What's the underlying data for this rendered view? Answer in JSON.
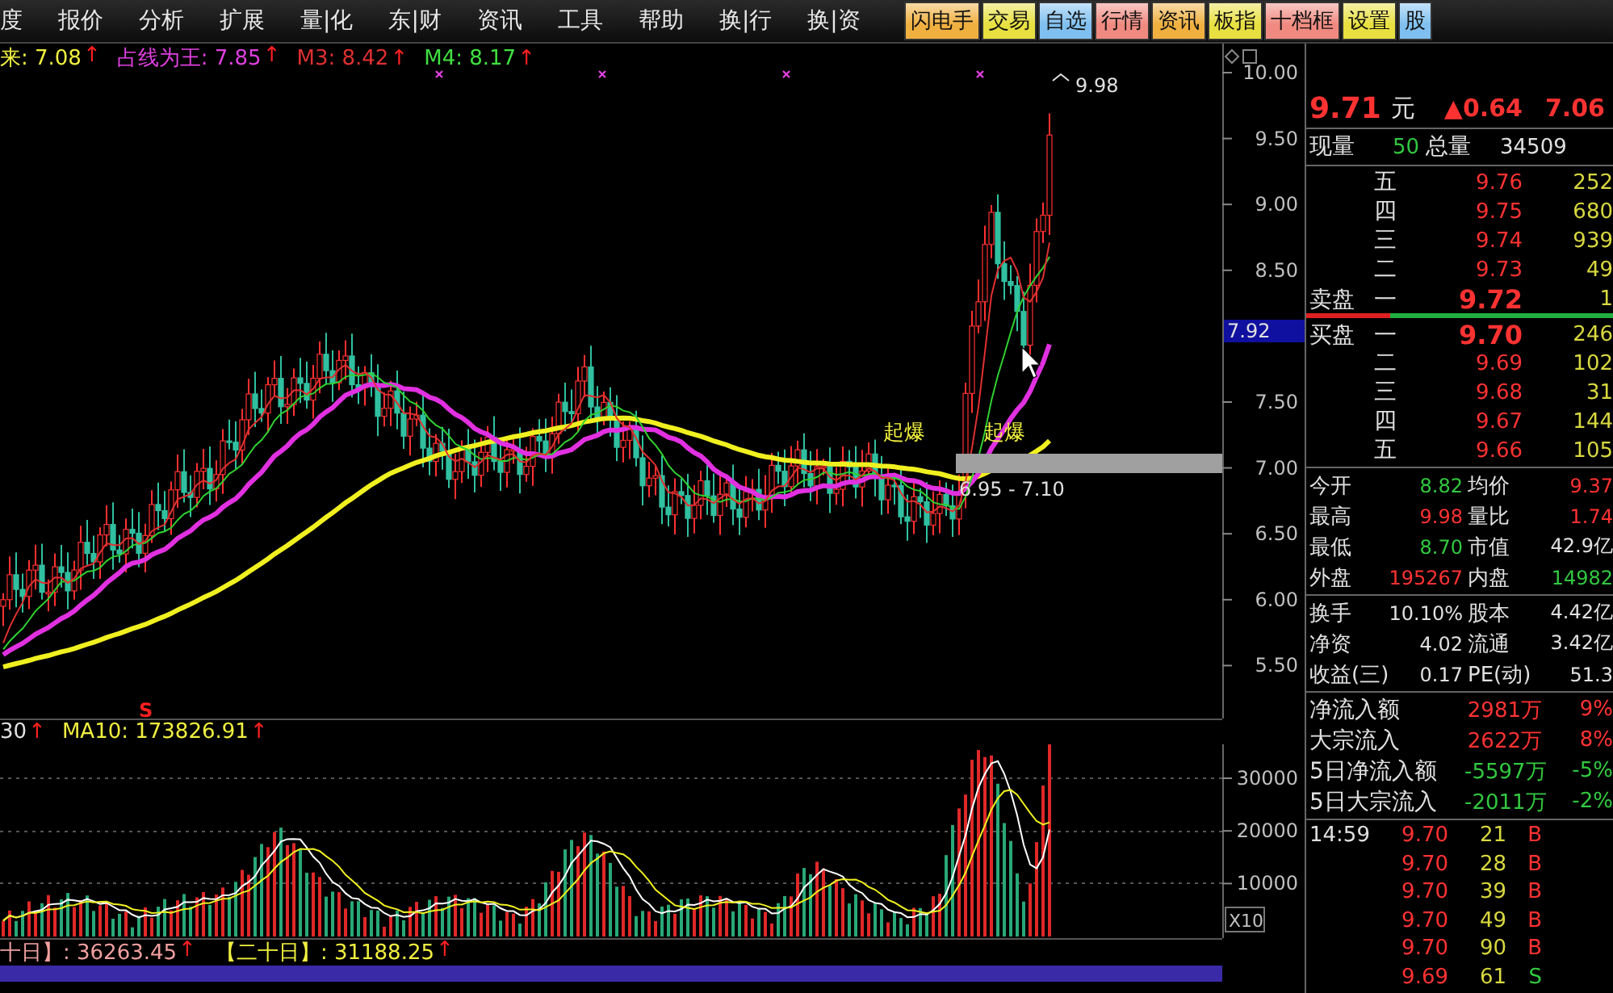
{
  "menu": [
    {
      "label": "度"
    },
    {
      "label": "报价"
    },
    {
      "label": "分析"
    },
    {
      "label": "扩展"
    },
    {
      "label": "量|化"
    },
    {
      "label": "东|财"
    },
    {
      "label": "资讯"
    },
    {
      "label": "工具"
    },
    {
      "label": "帮助"
    },
    {
      "label": "换|行"
    },
    {
      "label": "换|资"
    }
  ],
  "quick_buttons": [
    {
      "label": "闪电手",
      "color": "#f0b040"
    },
    {
      "label": "交易",
      "color": "#e8e040"
    },
    {
      "label": "自选",
      "color": "#80c0f0"
    },
    {
      "label": "行情",
      "color": "#f08a80"
    },
    {
      "label": "资讯",
      "color": "#f0b040"
    },
    {
      "label": "板指",
      "color": "#e8e040"
    },
    {
      "label": "十档框",
      "color": "#f08a80"
    },
    {
      "label": "设置",
      "color": "#e8e040"
    },
    {
      "label": "股",
      "color": "#80c0f0"
    }
  ],
  "indicators": [
    {
      "text": "来: 7.08",
      "color": "#f0f040",
      "arrow": "↑"
    },
    {
      "text": "占线为王: 7.85",
      "color": "#e040e0",
      "arrow": "↑"
    },
    {
      "text": "M3: 8.42",
      "color": "#e03030",
      "arrow": "↑"
    },
    {
      "text": "M4: 8.17",
      "color": "#40e040",
      "arrow": "↑"
    }
  ],
  "price_axis": [
    "10.00",
    "9.50",
    "9.00",
    "8.50",
    "7.50",
    "7.00",
    "6.50",
    "6.00",
    "5.50"
  ],
  "cursor_price": "7.92",
  "chart_notes": {
    "high": "9.98",
    "signals": [
      "起爆",
      "起爆"
    ],
    "band": "6.95 - 7.10",
    "marker": "S"
  },
  "volume_indicators": [
    {
      "text": "30",
      "color": "#e0e0e0",
      "arrow": "↑"
    },
    {
      "text": "MA10: 173826.91",
      "color": "#f0f040",
      "arrow": "↑"
    }
  ],
  "volume_axis": [
    "30000",
    "20000",
    "10000"
  ],
  "scale_button": "X10",
  "bottom_indicators": [
    {
      "text": "十日】: 36263.45",
      "color": "#f0a0a0",
      "arrow": "↑"
    },
    {
      "text": "【二十日】: 31188.25",
      "color": "#f0f040",
      "arrow": "↑"
    }
  ],
  "quote": {
    "price": "9.71",
    "unit": "元",
    "change": "▲0.64",
    "percent": "7.06"
  },
  "volume_row": [
    {
      "label": "现量",
      "value": "50",
      "color": "#32c840"
    },
    {
      "label": "总量",
      "value": "34509",
      "color": "#e0e0e0"
    }
  ],
  "asks": [
    {
      "level": "五",
      "price": "9.76",
      "volume": "252"
    },
    {
      "level": "四",
      "price": "9.75",
      "volume": "680"
    },
    {
      "level": "三",
      "price": "9.74",
      "volume": "939"
    },
    {
      "level": "二",
      "price": "9.73",
      "volume": "49"
    },
    {
      "side": "卖盘",
      "level": "一",
      "price": "9.72",
      "volume": "1"
    }
  ],
  "bids": [
    {
      "side": "买盘",
      "level": "一",
      "price": "9.70",
      "volume": "246"
    },
    {
      "level": "二",
      "price": "9.69",
      "volume": "102"
    },
    {
      "level": "三",
      "price": "9.68",
      "volume": "31"
    },
    {
      "level": "四",
      "price": "9.67",
      "volume": "144"
    },
    {
      "level": "五",
      "price": "9.66",
      "volume": "105"
    }
  ],
  "stats": [
    [
      {
        "label": "今开",
        "value": "8.82",
        "color": "#32c840"
      },
      {
        "label": "均价",
        "value": "9.37",
        "color": "#ff3232"
      }
    ],
    [
      {
        "label": "最高",
        "value": "9.98",
        "color": "#ff3232"
      },
      {
        "label": "量比",
        "value": "1.74",
        "color": "#ff3232"
      }
    ],
    [
      {
        "label": "最低",
        "value": "8.70",
        "color": "#32c840"
      },
      {
        "label": "市值",
        "value": "42.9亿",
        "color": "#e0e0e0"
      }
    ],
    [
      {
        "label": "外盘",
        "value": "195267",
        "color": "#ff3232"
      },
      {
        "label": "内盘",
        "value": "14982",
        "color": "#32c840"
      }
    ]
  ],
  "fundamentals": [
    [
      {
        "label": "换手",
        "value": "10.10%",
        "color": "#e0e0e0"
      },
      {
        "label": "股本",
        "value": "4.42亿",
        "color": "#e0e0e0"
      }
    ],
    [
      {
        "label": "净资",
        "value": "4.02",
        "color": "#e0e0e0"
      },
      {
        "label": "流通",
        "value": "3.42亿",
        "color": "#e0e0e0"
      }
    ],
    [
      {
        "label": "收益(三)",
        "value": "0.17",
        "color": "#e0e0e0"
      },
      {
        "label": "PE(动)",
        "value": "51.3",
        "color": "#e0e0e0"
      }
    ]
  ],
  "flows": [
    {
      "label": "净流入额",
      "amount": "2981万",
      "percent": "9%",
      "color": "#ff3232"
    },
    {
      "label": "大宗流入",
      "amount": "2622万",
      "percent": "8%",
      "color": "#ff3232"
    },
    {
      "label": "5日净流入额",
      "amount": "-5597万",
      "percent": "-5%",
      "color": "#32c840"
    },
    {
      "label": "5日大宗流入",
      "amount": "-2011万",
      "percent": "-2%",
      "color": "#32c840"
    }
  ],
  "ticks": [
    {
      "time": "14:59",
      "price": "9.70",
      "volume": "21",
      "side": "B",
      "color": "#ff3232"
    },
    {
      "price": "9.70",
      "volume": "28",
      "side": "B",
      "color": "#ff3232"
    },
    {
      "price": "9.70",
      "volume": "39",
      "side": "B",
      "color": "#ff3232"
    },
    {
      "price": "9.70",
      "volume": "49",
      "side": "B",
      "color": "#ff3232"
    },
    {
      "price": "9.70",
      "volume": "90",
      "side": "B",
      "color": "#ff3232"
    },
    {
      "price": "9.69",
      "volume": "61",
      "side": "S",
      "color": "#32c840"
    }
  ]
}
